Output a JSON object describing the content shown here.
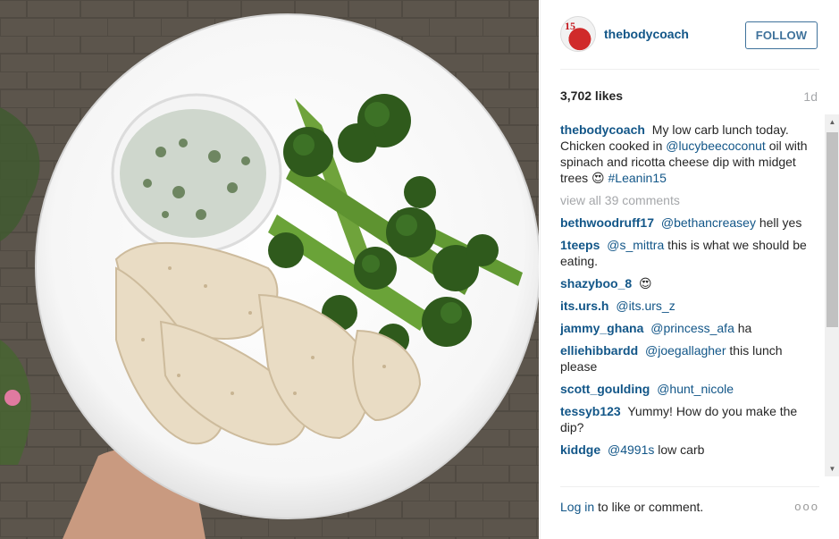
{
  "post": {
    "username": "thebodycoach",
    "avatar_badge": "15",
    "follow_label": "FOLLOW",
    "likes": "3,702 likes",
    "age": "1d"
  },
  "caption": {
    "author": "thebodycoach",
    "text_1": "My low carb lunch today. Chicken cooked in",
    "mention": "@lucybeecoconut",
    "text_2": "oil with spinach and ricotta cheese dip with midget trees",
    "emoji": "😍",
    "hashtag": "#Leanin15"
  },
  "view_all_comments": "view all 39 comments",
  "comments": [
    {
      "author": "bethwoodruff17",
      "mention": "@bethancreasey",
      "text": "hell yes"
    },
    {
      "author": "1teeps",
      "mention": "@s_mittra",
      "text": "this is what we should be eating."
    },
    {
      "author": "shazyboo_8",
      "mention": "",
      "text": "😍"
    },
    {
      "author": "its.urs.h",
      "mention": "@its.urs_z",
      "text": ""
    },
    {
      "author": "jammy_ghana",
      "mention": "@princess_afa",
      "text": "ha"
    },
    {
      "author": "elliehibbardd",
      "mention": "@joegallagher",
      "text": "this lunch please"
    },
    {
      "author": "scott_goulding",
      "mention": "@hunt_nicole",
      "text": ""
    },
    {
      "author": "tessyb123",
      "mention": "",
      "text": "Yummy! How do you make the dip?"
    },
    {
      "author": "kiddge",
      "mention": "@4991s",
      "text": "low carb"
    }
  ],
  "footer": {
    "login_link": "Log in",
    "login_rest": "to like or comment.",
    "more": "ooo"
  },
  "scrollbar": {
    "up_arrow": "▲",
    "down_arrow": "▼"
  },
  "colors": {
    "link_blue": "#125688",
    "follow_blue": "#3f729b",
    "muted_gray": "#a5a7aa"
  }
}
